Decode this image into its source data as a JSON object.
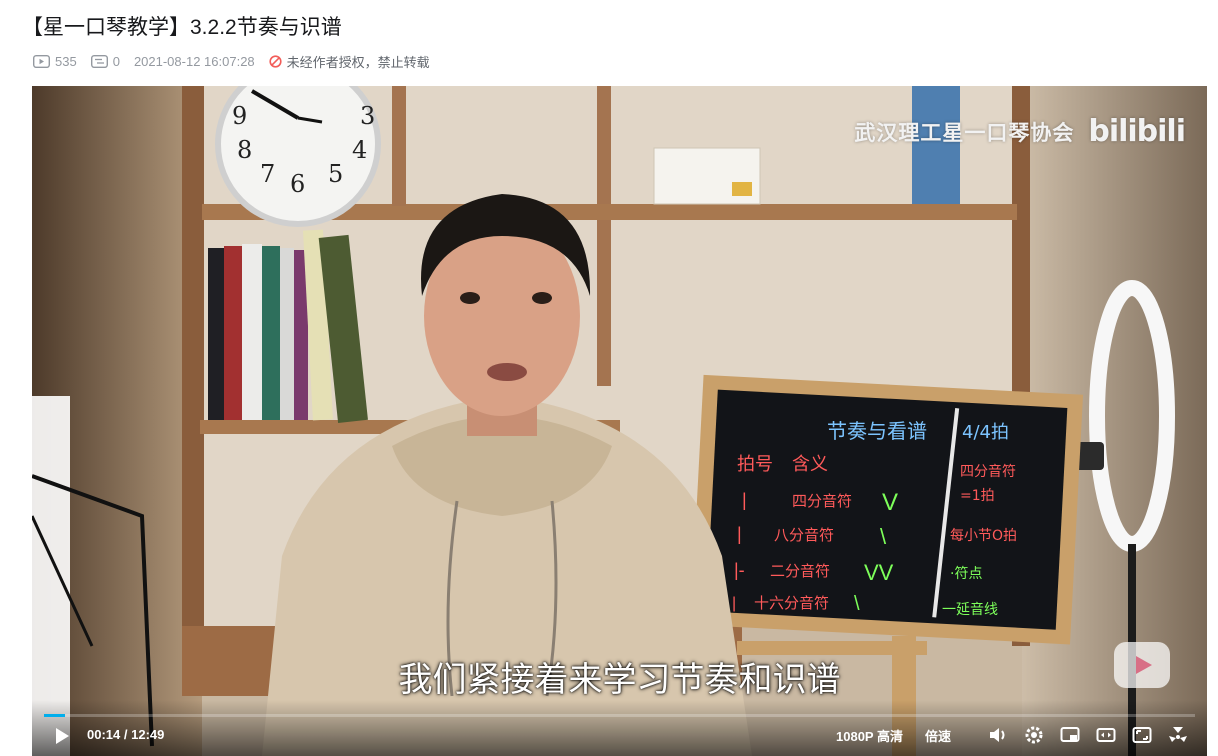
{
  "video": {
    "title": "【星一口琴教学】3.2.2节奏与识谱",
    "views": "535",
    "danmaku": "0",
    "date": "2021-08-12 16:07:28",
    "copyright_notice": "未经作者授权，禁止转载"
  },
  "player": {
    "watermark_text": "武汉理工星一口琴协会",
    "watermark_logo": "bilibili",
    "subtitle": "我们紧接着来学习节奏和识谱",
    "current_time": "00:14",
    "time_separator": "/",
    "duration": "12:49",
    "progress_fraction": 0.018,
    "quality_label": "1080P 高清",
    "speed_label": "倍速",
    "accent_color": "#00aeec"
  },
  "board": {
    "title": "节奏与看谱",
    "time_sig": "4/4拍",
    "headers": [
      "拍号",
      "含义"
    ],
    "rows": [
      {
        "mark": "|",
        "meaning": "四分音符",
        "check": "V"
      },
      {
        "mark": "|",
        "meaning": "八分音符",
        "check": "\\"
      },
      {
        "mark": "|-",
        "meaning": "二分音符",
        "check": "VV"
      },
      {
        "mark": "|",
        "meaning": "十六分音符",
        "check": "\\"
      }
    ],
    "right_notes": [
      "四分音符",
      "=1拍",
      "每小节O拍",
      "·符点",
      "一延音线"
    ]
  }
}
